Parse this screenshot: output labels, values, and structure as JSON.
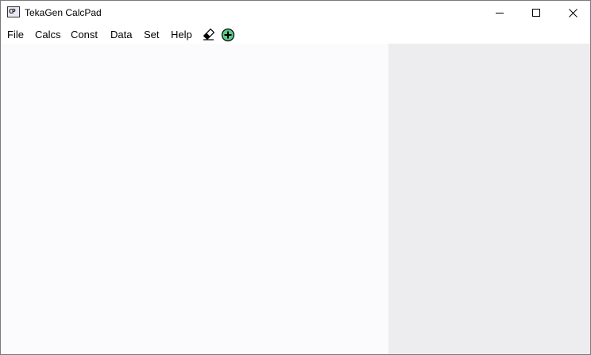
{
  "window": {
    "title": "TekaGen CalcPad",
    "icon": "calcpad-app-icon",
    "icon_glyph": "CP",
    "controls": {
      "minimize_icon": "minimize-icon",
      "maximize_icon": "maximize-icon",
      "close_icon": "close-icon"
    }
  },
  "menubar": {
    "items": [
      {
        "label": "File"
      },
      {
        "label": "Calcs"
      },
      {
        "label": "Const"
      },
      {
        "label": "Data"
      },
      {
        "label": "Set"
      },
      {
        "label": "Help"
      }
    ],
    "tools": [
      {
        "icon": "eraser-icon"
      },
      {
        "icon": "add-circle-icon",
        "color": "#5cc98a"
      }
    ]
  },
  "colors": {
    "editor_bg": "#fbfbfe",
    "results_bg": "#ededf0"
  }
}
